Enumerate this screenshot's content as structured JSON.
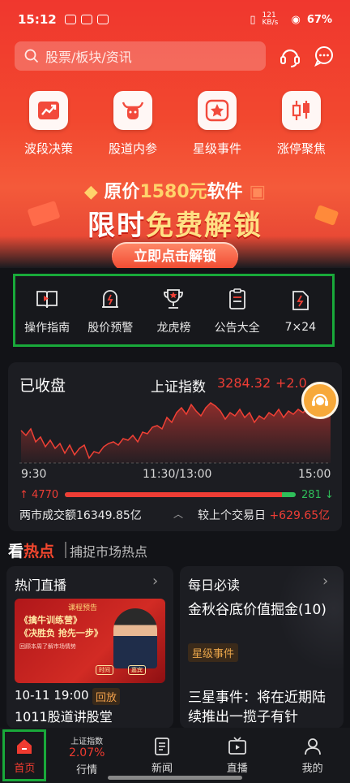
{
  "status_bar": {
    "time": "15:12",
    "net_speed": "121 KB/s",
    "battery": "67%"
  },
  "search": {
    "placeholder": "股票/板块/资讯"
  },
  "header_icons": {
    "service": "headset-icon",
    "messages": "chat-icon"
  },
  "quick_access": [
    {
      "label": "波段决策",
      "icon": "trend-up-icon"
    },
    {
      "label": "股道内参",
      "icon": "bull-icon"
    },
    {
      "label": "星级事件",
      "icon": "star-icon"
    },
    {
      "label": "涨停聚焦",
      "icon": "candlestick-icon"
    }
  ],
  "banner": {
    "line1_prefix": "原价",
    "line1_price": "1580元",
    "line1_suffix": "软件",
    "line2_a": "限时",
    "line2_b": "免费解锁",
    "cta": "立即点击解锁"
  },
  "tools": [
    {
      "label": "操作指南",
      "icon": "book-icon"
    },
    {
      "label": "股价预警",
      "icon": "alarm-icon"
    },
    {
      "label": "龙虎榜",
      "icon": "trophy-icon"
    },
    {
      "label": "公告大全",
      "icon": "clipboard-icon"
    },
    {
      "label": "7×24",
      "icon": "flash-doc-icon"
    }
  ],
  "market": {
    "status": "已收盘",
    "index_name": "上证指数",
    "index_value": "3284.32",
    "index_change": "+2.0",
    "time_labels": [
      "9:30",
      "11:30/13:00",
      "15:00"
    ],
    "advancers": "4770",
    "decliners": "281",
    "advance_ratio": 0.94,
    "turnover_label": "两市成交额",
    "turnover_value": "16349.85亿",
    "prev_day_label": "较上个交易日",
    "prev_day_value": "+629.65亿",
    "colors": {
      "up": "#ee3d35",
      "down": "#2fbf5a"
    }
  },
  "hot": {
    "title_a": "看",
    "title_b": "热点",
    "subtitle": "捕捉市场热点"
  },
  "live_card": {
    "title": "热门直播",
    "poster": {
      "tag": "课程预告",
      "line1": "《擒牛训练营》",
      "line2": "《决胜负 抢先一步》",
      "line3": "回顾本周了解市场情势",
      "btn1": "时间",
      "btn2": "嘉宾"
    },
    "time": "10-11 19:00",
    "badge": "回放",
    "show_title": "1011股道讲股堂"
  },
  "read_card": {
    "title": "每日必读",
    "article1": "金秋谷底价值掘金(10)",
    "badge": "星级事件",
    "article2": "三星事件：将在近期陆续推出一揽子有针"
  },
  "tabbar": {
    "home": "首页",
    "quote_index": "上证指数",
    "quote_pct": "2.07%",
    "quote": "行情",
    "news": "新闻",
    "live": "直播",
    "mine": "我的"
  }
}
